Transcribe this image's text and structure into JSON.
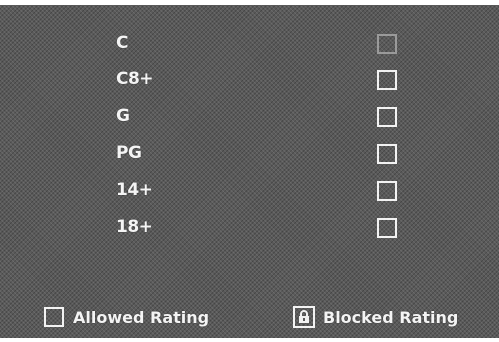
{
  "ratings": [
    {
      "label": "C",
      "checked": false
    },
    {
      "label": "C8+",
      "checked": false
    },
    {
      "label": "G",
      "checked": false
    },
    {
      "label": "PG",
      "checked": false
    },
    {
      "label": "14+",
      "checked": false
    },
    {
      "label": "18+",
      "checked": false
    }
  ],
  "legend": {
    "allowed_label": "Allowed Rating",
    "blocked_label": "Blocked Rating"
  },
  "icons": {
    "allowed": "empty-checkbox-icon",
    "blocked": "lock-icon"
  },
  "colors": {
    "background": "#5a5a5a",
    "text": "#f4f4f4"
  }
}
